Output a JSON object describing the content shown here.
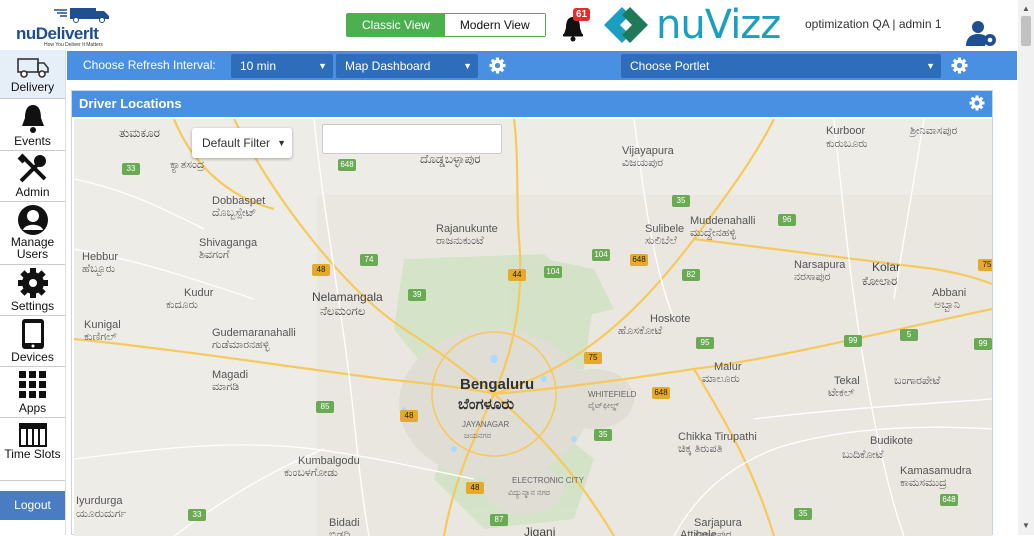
{
  "header": {
    "brand": "nuDeliverIt",
    "tagline": "How You Deliver It Matters",
    "view_toggle": {
      "classic": "Classic View",
      "modern": "Modern View",
      "selected": "Classic View"
    },
    "notifications": {
      "count": "61"
    },
    "partner_brand": "nuVizz",
    "user_label": "optimization QA | admin 1"
  },
  "sidebar": {
    "items": [
      {
        "label": "Delivery",
        "icon": "truck-icon"
      },
      {
        "label": "Events",
        "icon": "bell-icon"
      },
      {
        "label": "Admin",
        "icon": "tools-icon"
      },
      {
        "label": "Manage Users",
        "icon": "user-icon"
      },
      {
        "label": "Settings",
        "icon": "gear-icon"
      },
      {
        "label": "Devices",
        "icon": "tablet-icon"
      },
      {
        "label": "Apps",
        "icon": "grid-icon"
      },
      {
        "label": "Time Slots",
        "icon": "calendar-icon"
      }
    ],
    "logout": "Logout"
  },
  "toolbar": {
    "refresh_label": "Choose Refresh Interval:",
    "refresh_value": "10 min",
    "dashboard_value": "Map Dashboard",
    "portlet_value": "Choose Portlet"
  },
  "portlet": {
    "title": "Driver Locations",
    "filter_value": "Default Filter",
    "search_value": ""
  },
  "map": {
    "places": [
      {
        "name": "ತುಮಕೂರ",
        "cls": "mid"
      },
      {
        "name": "ಕ್ಯಾತಸಂದ್ರ",
        "cls": ""
      },
      {
        "name": "Dobbaspet",
        "cls": ""
      },
      {
        "name": "ದೊಬ್ಬಸ್ಪೇಟ್",
        "cls": ""
      },
      {
        "name": "Shivaganga",
        "cls": ""
      },
      {
        "name": "ಶಿವಗಂಗೆ",
        "cls": ""
      },
      {
        "name": "Hebbur",
        "cls": ""
      },
      {
        "name": "ಹೆಬ್ಬೂರು",
        "cls": ""
      },
      {
        "name": "Kudur",
        "cls": ""
      },
      {
        "name": "ಕುದೂರು",
        "cls": ""
      },
      {
        "name": "Kunigal",
        "cls": ""
      },
      {
        "name": "ಕುಣಿಗಲ್",
        "cls": ""
      },
      {
        "name": "Gudemaranahalli",
        "cls": ""
      },
      {
        "name": "ಗುಡೆಮಾರನಹಳ್ಳಿ",
        "cls": ""
      },
      {
        "name": "Magadi",
        "cls": ""
      },
      {
        "name": "ಮಾಗಡಿ",
        "cls": ""
      },
      {
        "name": "Iyurdurga",
        "cls": ""
      },
      {
        "name": "ಯೂರುದುರ್ಗ",
        "cls": ""
      },
      {
        "name": "Bidadi",
        "cls": ""
      },
      {
        "name": "ಬಿಡದಿ",
        "cls": ""
      },
      {
        "name": "Kumbalgodu",
        "cls": ""
      },
      {
        "name": "ಕುಂಬಳಗೋಡು",
        "cls": ""
      },
      {
        "name": "Nelamangala",
        "cls": "mid"
      },
      {
        "name": "ನೆಲಮಂಗಲ",
        "cls": "mid"
      },
      {
        "name": "Rajanukunte",
        "cls": ""
      },
      {
        "name": "ರಾಜನುಕುಂಟೆ",
        "cls": ""
      },
      {
        "name": "ದೊಡ್ಡಬಳ್ಳಾಪುರ",
        "cls": "mid"
      },
      {
        "name": "Vijayapura",
        "cls": ""
      },
      {
        "name": "ವಿಜಯಪುರ",
        "cls": ""
      },
      {
        "name": "Sulibele",
        "cls": ""
      },
      {
        "name": "ಸುಲಿಬೆಲೆ",
        "cls": ""
      },
      {
        "name": "Muddenahalli",
        "cls": ""
      },
      {
        "name": "ಮುದ್ದೇನಹಳ್ಳಿ",
        "cls": ""
      },
      {
        "name": "Kurboor",
        "cls": ""
      },
      {
        "name": "ಕುರುಬೂರು",
        "cls": ""
      },
      {
        "name": "ಶ್ರೀನಿವಾಸಪುರ",
        "cls": ""
      },
      {
        "name": "Narsapura",
        "cls": ""
      },
      {
        "name": "ನರಸಾಪುರ",
        "cls": ""
      },
      {
        "name": "Kolar",
        "cls": "mid"
      },
      {
        "name": "ಕೋಲಾರ",
        "cls": "mid"
      },
      {
        "name": "Abbani",
        "cls": ""
      },
      {
        "name": "ಅಬ್ಬಾನಿ",
        "cls": ""
      },
      {
        "name": "Hoskote",
        "cls": ""
      },
      {
        "name": "ಹೊಸಕೋಟೆ",
        "cls": ""
      },
      {
        "name": "Bengaluru",
        "cls": "big"
      },
      {
        "name": "ಬೆಂಗಳೂರು",
        "cls": "big"
      },
      {
        "name": "JAYANAGAR",
        "cls": "small"
      },
      {
        "name": "ಜಯನಗರ",
        "cls": "small"
      },
      {
        "name": "WHITEFIELD",
        "cls": "small"
      },
      {
        "name": "ವೈಟ್‌ಫೀಲ್ಡ್",
        "cls": "small"
      },
      {
        "name": "ELECTRONIC CITY",
        "cls": "small"
      },
      {
        "name": "ವಿದ್ಯುನ್ಮಾನ ನಗರ",
        "cls": "small"
      },
      {
        "name": "Malur",
        "cls": ""
      },
      {
        "name": "ಮಾಲೂರು",
        "cls": ""
      },
      {
        "name": "Tekal",
        "cls": ""
      },
      {
        "name": "ಟೇಕಲ್",
        "cls": ""
      },
      {
        "name": "ಬಂಗಾರಪೇಟೆ",
        "cls": ""
      },
      {
        "name": "Chikka Tirupathi",
        "cls": ""
      },
      {
        "name": "ಚಿಕ್ಕ ತಿರುಪತಿ",
        "cls": ""
      },
      {
        "name": "Budikote",
        "cls": ""
      },
      {
        "name": "ಬುದಿಕೋಟೆ",
        "cls": ""
      },
      {
        "name": "Kamasamudra",
        "cls": ""
      },
      {
        "name": "ಕಾಮಸಮುದ್ರ",
        "cls": ""
      },
      {
        "name": "Sarjapura",
        "cls": ""
      },
      {
        "name": "ಸರ್ಜಾಪುರ",
        "cls": ""
      },
      {
        "name": "Jigani",
        "cls": "mid"
      },
      {
        "name": "Attibele",
        "cls": ""
      }
    ],
    "shields": [
      {
        "n": "33",
        "type": "n"
      },
      {
        "n": "648",
        "type": "n"
      },
      {
        "n": "74",
        "type": "n"
      },
      {
        "n": "48",
        "type": "s"
      },
      {
        "n": "39",
        "type": "n"
      },
      {
        "n": "44",
        "type": "s"
      },
      {
        "n": "104",
        "type": "n"
      },
      {
        "n": "104",
        "type": "n"
      },
      {
        "n": "648",
        "type": "s"
      },
      {
        "n": "35",
        "type": "n"
      },
      {
        "n": "96",
        "type": "n"
      },
      {
        "n": "82",
        "type": "n"
      },
      {
        "n": "75",
        "type": "s"
      },
      {
        "n": "75",
        "type": "s"
      },
      {
        "n": "95",
        "type": "n"
      },
      {
        "n": "99",
        "type": "n"
      },
      {
        "n": "5",
        "type": "n"
      },
      {
        "n": "648",
        "type": "s"
      },
      {
        "n": "85",
        "type": "n"
      },
      {
        "n": "48",
        "type": "s"
      },
      {
        "n": "35",
        "type": "n"
      },
      {
        "n": "48",
        "type": "s"
      },
      {
        "n": "87",
        "type": "n"
      },
      {
        "n": "33",
        "type": "n"
      },
      {
        "n": "35",
        "type": "n"
      },
      {
        "n": "99",
        "type": "n"
      },
      {
        "n": "648",
        "type": "n"
      }
    ]
  }
}
